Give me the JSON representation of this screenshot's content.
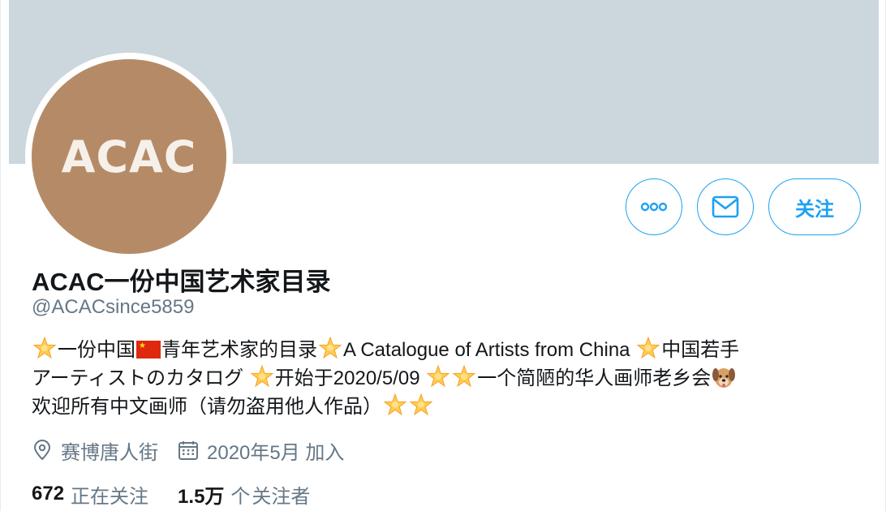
{
  "profile": {
    "avatar_text": "ACAC",
    "display_name": "ACAC一份中国艺术家目录",
    "handle": "@ACACsince5859",
    "follow_label": "关注",
    "bio": {
      "p1": "一份中国",
      "p2": "青年艺术家的目录",
      "p3": "A Catalogue of Artists from China ",
      "p4": "中国若手",
      "p5": "アーティストのカタログ ",
      "p6": "开始于2020/5/09 ",
      "p7": "一个简陋的华人画师老乡会",
      "p8": "欢迎所有中文画师（请勿盗用他人作品）"
    },
    "location": "赛博唐人街",
    "joined": "2020年5月 加入",
    "following_count": "672",
    "following_label": "正在关注",
    "followers_count": "1.5万",
    "followers_pre": "个",
    "followers_label": "关注者"
  },
  "icons": {
    "more": "more-dots-icon",
    "message": "envelope-icon",
    "location": "location-pin-icon",
    "calendar": "calendar-icon",
    "star": "glowing-star-emoji",
    "flag": "china-flag-emoji",
    "dog": "dog-face-emoji"
  },
  "colors": {
    "accent": "#1da1f2",
    "banner": "#ccd6dd",
    "avatar_bg": "#b58b67",
    "secondary_text": "#657786"
  }
}
